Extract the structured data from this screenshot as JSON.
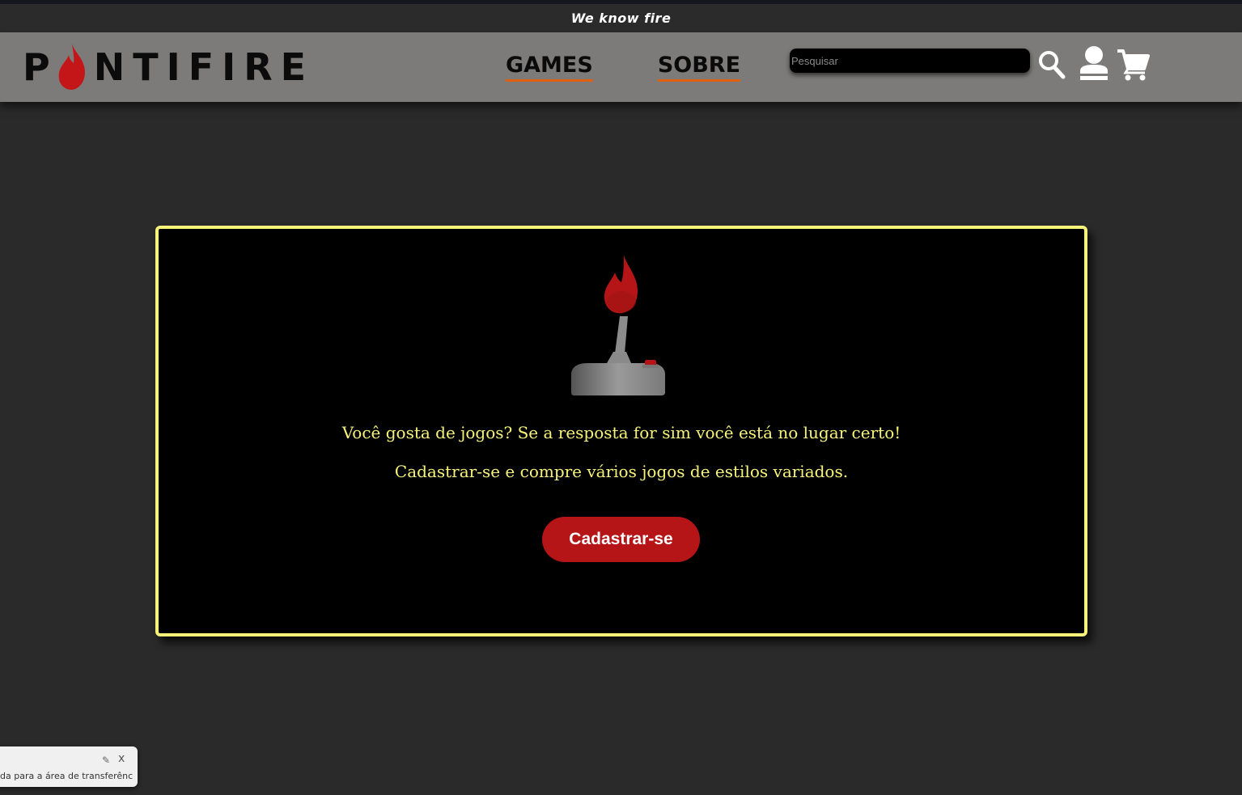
{
  "top_bar": {
    "tagline": "We know fire"
  },
  "header": {
    "logo_text_before": "P",
    "logo_text_after": "NTIFIRE",
    "nav": [
      {
        "label": "GAMES"
      },
      {
        "label": "SOBRE"
      }
    ],
    "search": {
      "placeholder": "Pesquisar",
      "value": ""
    },
    "icons": [
      "search-icon",
      "user-icon",
      "cart-icon"
    ]
  },
  "main": {
    "icon": "joystick-flame-icon",
    "message_1": "Você gosta de jogos? Se a resposta for sim você está no lugar certo!",
    "message_2": "Cadastrar-se e compre vários jogos de estilos variados.",
    "signup_label": "Cadastrar-se"
  },
  "toast": {
    "text": "da para a área de transferência",
    "close": "x"
  },
  "colors": {
    "background": "#2a2a2a",
    "header": "#7c7b79",
    "accent_yellow": "#f7f37a",
    "button_red": "#b51516",
    "nav_underline": "#e06010"
  }
}
